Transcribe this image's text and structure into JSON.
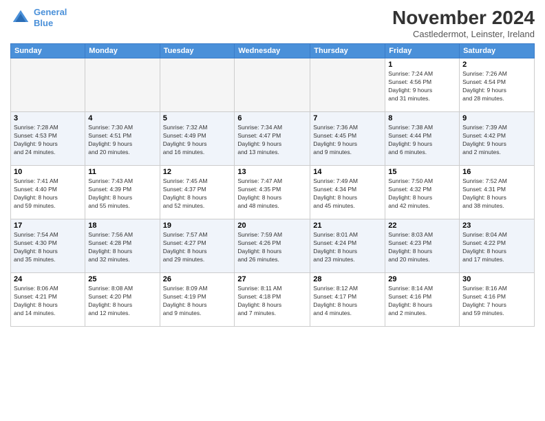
{
  "logo": {
    "line1": "General",
    "line2": "Blue"
  },
  "title": "November 2024",
  "subtitle": "Castledermot, Leinster, Ireland",
  "days_of_week": [
    "Sunday",
    "Monday",
    "Tuesday",
    "Wednesday",
    "Thursday",
    "Friday",
    "Saturday"
  ],
  "weeks": [
    {
      "cells": [
        {
          "day": "",
          "info": ""
        },
        {
          "day": "",
          "info": ""
        },
        {
          "day": "",
          "info": ""
        },
        {
          "day": "",
          "info": ""
        },
        {
          "day": "",
          "info": ""
        },
        {
          "day": "1",
          "info": "Sunrise: 7:24 AM\nSunset: 4:56 PM\nDaylight: 9 hours\nand 31 minutes."
        },
        {
          "day": "2",
          "info": "Sunrise: 7:26 AM\nSunset: 4:54 PM\nDaylight: 9 hours\nand 28 minutes."
        }
      ]
    },
    {
      "cells": [
        {
          "day": "3",
          "info": "Sunrise: 7:28 AM\nSunset: 4:53 PM\nDaylight: 9 hours\nand 24 minutes."
        },
        {
          "day": "4",
          "info": "Sunrise: 7:30 AM\nSunset: 4:51 PM\nDaylight: 9 hours\nand 20 minutes."
        },
        {
          "day": "5",
          "info": "Sunrise: 7:32 AM\nSunset: 4:49 PM\nDaylight: 9 hours\nand 16 minutes."
        },
        {
          "day": "6",
          "info": "Sunrise: 7:34 AM\nSunset: 4:47 PM\nDaylight: 9 hours\nand 13 minutes."
        },
        {
          "day": "7",
          "info": "Sunrise: 7:36 AM\nSunset: 4:45 PM\nDaylight: 9 hours\nand 9 minutes."
        },
        {
          "day": "8",
          "info": "Sunrise: 7:38 AM\nSunset: 4:44 PM\nDaylight: 9 hours\nand 6 minutes."
        },
        {
          "day": "9",
          "info": "Sunrise: 7:39 AM\nSunset: 4:42 PM\nDaylight: 9 hours\nand 2 minutes."
        }
      ]
    },
    {
      "cells": [
        {
          "day": "10",
          "info": "Sunrise: 7:41 AM\nSunset: 4:40 PM\nDaylight: 8 hours\nand 59 minutes."
        },
        {
          "day": "11",
          "info": "Sunrise: 7:43 AM\nSunset: 4:39 PM\nDaylight: 8 hours\nand 55 minutes."
        },
        {
          "day": "12",
          "info": "Sunrise: 7:45 AM\nSunset: 4:37 PM\nDaylight: 8 hours\nand 52 minutes."
        },
        {
          "day": "13",
          "info": "Sunrise: 7:47 AM\nSunset: 4:35 PM\nDaylight: 8 hours\nand 48 minutes."
        },
        {
          "day": "14",
          "info": "Sunrise: 7:49 AM\nSunset: 4:34 PM\nDaylight: 8 hours\nand 45 minutes."
        },
        {
          "day": "15",
          "info": "Sunrise: 7:50 AM\nSunset: 4:32 PM\nDaylight: 8 hours\nand 42 minutes."
        },
        {
          "day": "16",
          "info": "Sunrise: 7:52 AM\nSunset: 4:31 PM\nDaylight: 8 hours\nand 38 minutes."
        }
      ]
    },
    {
      "cells": [
        {
          "day": "17",
          "info": "Sunrise: 7:54 AM\nSunset: 4:30 PM\nDaylight: 8 hours\nand 35 minutes."
        },
        {
          "day": "18",
          "info": "Sunrise: 7:56 AM\nSunset: 4:28 PM\nDaylight: 8 hours\nand 32 minutes."
        },
        {
          "day": "19",
          "info": "Sunrise: 7:57 AM\nSunset: 4:27 PM\nDaylight: 8 hours\nand 29 minutes."
        },
        {
          "day": "20",
          "info": "Sunrise: 7:59 AM\nSunset: 4:26 PM\nDaylight: 8 hours\nand 26 minutes."
        },
        {
          "day": "21",
          "info": "Sunrise: 8:01 AM\nSunset: 4:24 PM\nDaylight: 8 hours\nand 23 minutes."
        },
        {
          "day": "22",
          "info": "Sunrise: 8:03 AM\nSunset: 4:23 PM\nDaylight: 8 hours\nand 20 minutes."
        },
        {
          "day": "23",
          "info": "Sunrise: 8:04 AM\nSunset: 4:22 PM\nDaylight: 8 hours\nand 17 minutes."
        }
      ]
    },
    {
      "cells": [
        {
          "day": "24",
          "info": "Sunrise: 8:06 AM\nSunset: 4:21 PM\nDaylight: 8 hours\nand 14 minutes."
        },
        {
          "day": "25",
          "info": "Sunrise: 8:08 AM\nSunset: 4:20 PM\nDaylight: 8 hours\nand 12 minutes."
        },
        {
          "day": "26",
          "info": "Sunrise: 8:09 AM\nSunset: 4:19 PM\nDaylight: 8 hours\nand 9 minutes."
        },
        {
          "day": "27",
          "info": "Sunrise: 8:11 AM\nSunset: 4:18 PM\nDaylight: 8 hours\nand 7 minutes."
        },
        {
          "day": "28",
          "info": "Sunrise: 8:12 AM\nSunset: 4:17 PM\nDaylight: 8 hours\nand 4 minutes."
        },
        {
          "day": "29",
          "info": "Sunrise: 8:14 AM\nSunset: 4:16 PM\nDaylight: 8 hours\nand 2 minutes."
        },
        {
          "day": "30",
          "info": "Sunrise: 8:16 AM\nSunset: 4:16 PM\nDaylight: 7 hours\nand 59 minutes."
        }
      ]
    }
  ]
}
